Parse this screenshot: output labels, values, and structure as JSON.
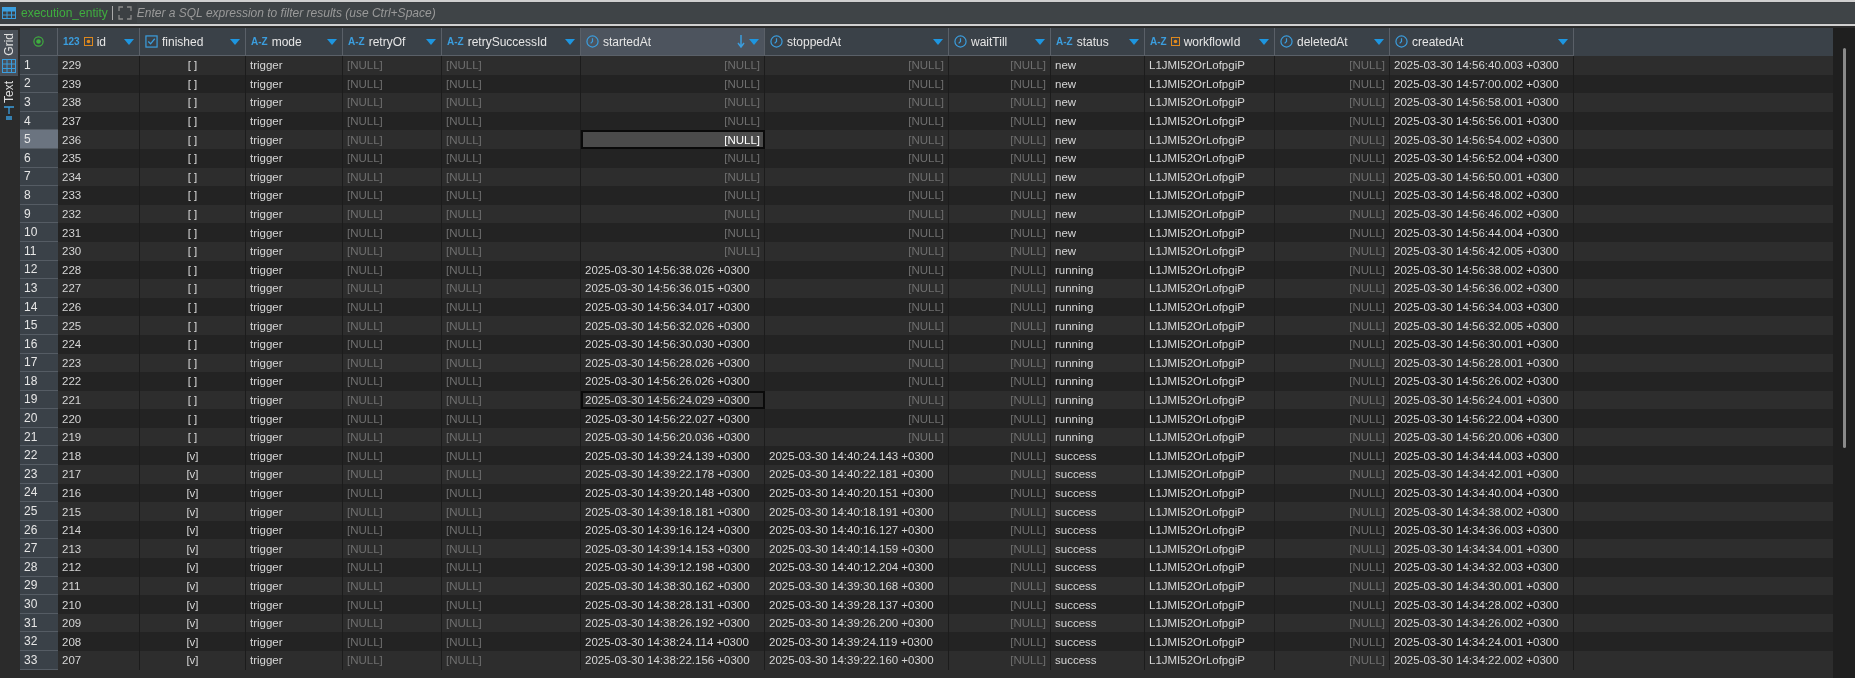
{
  "filter_bar": {
    "table_name": "execution_entity",
    "placeholder": "Enter a SQL expression to filter results (use Ctrl+Space)"
  },
  "view_tabs": [
    {
      "label": "Grid",
      "selected": true
    },
    {
      "label": "Text",
      "selected": false
    }
  ],
  "columns": [
    {
      "label": "id",
      "kind": "number",
      "type_label": "123",
      "key": true,
      "sorted": false
    },
    {
      "label": "finished",
      "kind": "boolean",
      "key": false,
      "sorted": false
    },
    {
      "label": "mode",
      "kind": "text",
      "type_label": "A-Z",
      "key": false,
      "sorted": false
    },
    {
      "label": "retryOf",
      "kind": "text",
      "type_label": "A-Z",
      "key": false,
      "sorted": false
    },
    {
      "label": "retrySuccessId",
      "kind": "text",
      "type_label": "A-Z",
      "key": false,
      "sorted": false
    },
    {
      "label": "startedAt",
      "kind": "datetime",
      "key": false,
      "sorted": true
    },
    {
      "label": "stoppedAt",
      "kind": "datetime",
      "key": false,
      "sorted": false
    },
    {
      "label": "waitTill",
      "kind": "datetime",
      "key": false,
      "sorted": false
    },
    {
      "label": "status",
      "kind": "text",
      "type_label": "A-Z",
      "key": false,
      "sorted": false
    },
    {
      "label": "workflowId",
      "kind": "text",
      "type_label": "A-Z",
      "key": true,
      "sorted": false
    },
    {
      "label": "deletedAt",
      "kind": "datetime",
      "key": false,
      "sorted": false
    },
    {
      "label": "createdAt",
      "kind": "datetime",
      "key": false,
      "sorted": false
    }
  ],
  "rows": [
    {
      "number": "1",
      "selected": false,
      "outlined": false,
      "cells": [
        "229",
        "[ ]",
        "trigger",
        {
          "text": "[NULL]",
          "null": true
        },
        {
          "text": "[NULL]",
          "null": true
        },
        {
          "text": "[NULL]",
          "null": true
        },
        {
          "text": "[NULL]",
          "null": true
        },
        {
          "text": "[NULL]",
          "null": true
        },
        "new",
        "L1JMI52OrLofpgiP",
        {
          "text": "[NULL]",
          "null": true
        },
        "2025-03-30 14:56:40.003 +0300"
      ]
    },
    {
      "number": "2",
      "selected": false,
      "outlined": false,
      "cells": [
        "239",
        "[ ]",
        "trigger",
        {
          "text": "[NULL]",
          "null": true
        },
        {
          "text": "[NULL]",
          "null": true
        },
        {
          "text": "[NULL]",
          "null": true
        },
        {
          "text": "[NULL]",
          "null": true
        },
        {
          "text": "[NULL]",
          "null": true
        },
        "new",
        "L1JMI52OrLofpgiP",
        {
          "text": "[NULL]",
          "null": true
        },
        "2025-03-30 14:57:00.002 +0300"
      ]
    },
    {
      "number": "3",
      "selected": false,
      "outlined": false,
      "cells": [
        "238",
        "[ ]",
        "trigger",
        {
          "text": "[NULL]",
          "null": true
        },
        {
          "text": "[NULL]",
          "null": true
        },
        {
          "text": "[NULL]",
          "null": true
        },
        {
          "text": "[NULL]",
          "null": true
        },
        {
          "text": "[NULL]",
          "null": true
        },
        "new",
        "L1JMI52OrLofpgiP",
        {
          "text": "[NULL]",
          "null": true
        },
        "2025-03-30 14:56:58.001 +0300"
      ]
    },
    {
      "number": "4",
      "selected": false,
      "outlined": false,
      "cells": [
        "237",
        "[ ]",
        "trigger",
        {
          "text": "[NULL]",
          "null": true
        },
        {
          "text": "[NULL]",
          "null": true
        },
        {
          "text": "[NULL]",
          "null": true
        },
        {
          "text": "[NULL]",
          "null": true
        },
        {
          "text": "[NULL]",
          "null": true
        },
        "new",
        "L1JMI52OrLofpgiP",
        {
          "text": "[NULL]",
          "null": true
        },
        "2025-03-30 14:56:56.001 +0300"
      ]
    },
    {
      "number": "5",
      "selected": true,
      "outlined": false,
      "cells": [
        "236",
        "[ ]",
        "trigger",
        {
          "text": "[NULL]",
          "null": true
        },
        {
          "text": "[NULL]",
          "null": true
        },
        {
          "text": "[NULL]",
          "null": true
        },
        {
          "text": "[NULL]",
          "null": true
        },
        {
          "text": "[NULL]",
          "null": true
        },
        "new",
        "L1JMI52OrLofpgiP",
        {
          "text": "[NULL]",
          "null": true
        },
        "2025-03-30 14:56:54.002 +0300"
      ]
    },
    {
      "number": "6",
      "selected": false,
      "outlined": false,
      "cells": [
        "235",
        "[ ]",
        "trigger",
        {
          "text": "[NULL]",
          "null": true
        },
        {
          "text": "[NULL]",
          "null": true
        },
        {
          "text": "[NULL]",
          "null": true
        },
        {
          "text": "[NULL]",
          "null": true
        },
        {
          "text": "[NULL]",
          "null": true
        },
        "new",
        "L1JMI52OrLofpgiP",
        {
          "text": "[NULL]",
          "null": true
        },
        "2025-03-30 14:56:52.004 +0300"
      ]
    },
    {
      "number": "7",
      "selected": false,
      "outlined": false,
      "cells": [
        "234",
        "[ ]",
        "trigger",
        {
          "text": "[NULL]",
          "null": true
        },
        {
          "text": "[NULL]",
          "null": true
        },
        {
          "text": "[NULL]",
          "null": true
        },
        {
          "text": "[NULL]",
          "null": true
        },
        {
          "text": "[NULL]",
          "null": true
        },
        "new",
        "L1JMI52OrLofpgiP",
        {
          "text": "[NULL]",
          "null": true
        },
        "2025-03-30 14:56:50.001 +0300"
      ]
    },
    {
      "number": "8",
      "selected": false,
      "outlined": false,
      "cells": [
        "233",
        "[ ]",
        "trigger",
        {
          "text": "[NULL]",
          "null": true
        },
        {
          "text": "[NULL]",
          "null": true
        },
        {
          "text": "[NULL]",
          "null": true
        },
        {
          "text": "[NULL]",
          "null": true
        },
        {
          "text": "[NULL]",
          "null": true
        },
        "new",
        "L1JMI52OrLofpgiP",
        {
          "text": "[NULL]",
          "null": true
        },
        "2025-03-30 14:56:48.002 +0300"
      ]
    },
    {
      "number": "9",
      "selected": false,
      "outlined": false,
      "cells": [
        "232",
        "[ ]",
        "trigger",
        {
          "text": "[NULL]",
          "null": true
        },
        {
          "text": "[NULL]",
          "null": true
        },
        {
          "text": "[NULL]",
          "null": true
        },
        {
          "text": "[NULL]",
          "null": true
        },
        {
          "text": "[NULL]",
          "null": true
        },
        "new",
        "L1JMI52OrLofpgiP",
        {
          "text": "[NULL]",
          "null": true
        },
        "2025-03-30 14:56:46.002 +0300"
      ]
    },
    {
      "number": "10",
      "selected": false,
      "outlined": false,
      "cells": [
        "231",
        "[ ]",
        "trigger",
        {
          "text": "[NULL]",
          "null": true
        },
        {
          "text": "[NULL]",
          "null": true
        },
        {
          "text": "[NULL]",
          "null": true
        },
        {
          "text": "[NULL]",
          "null": true
        },
        {
          "text": "[NULL]",
          "null": true
        },
        "new",
        "L1JMI52OrLofpgiP",
        {
          "text": "[NULL]",
          "null": true
        },
        "2025-03-30 14:56:44.004 +0300"
      ]
    },
    {
      "number": "11",
      "selected": false,
      "outlined": false,
      "cells": [
        "230",
        "[ ]",
        "trigger",
        {
          "text": "[NULL]",
          "null": true
        },
        {
          "text": "[NULL]",
          "null": true
        },
        {
          "text": "[NULL]",
          "null": true
        },
        {
          "text": "[NULL]",
          "null": true
        },
        {
          "text": "[NULL]",
          "null": true
        },
        "new",
        "L1JMI52OrLofpgiP",
        {
          "text": "[NULL]",
          "null": true
        },
        "2025-03-30 14:56:42.005 +0300"
      ]
    },
    {
      "number": "12",
      "selected": false,
      "outlined": false,
      "cells": [
        "228",
        "[ ]",
        "trigger",
        {
          "text": "[NULL]",
          "null": true
        },
        {
          "text": "[NULL]",
          "null": true
        },
        "2025-03-30 14:56:38.026 +0300",
        {
          "text": "[NULL]",
          "null": true
        },
        {
          "text": "[NULL]",
          "null": true
        },
        "running",
        "L1JMI52OrLofpgiP",
        {
          "text": "[NULL]",
          "null": true
        },
        "2025-03-30 14:56:38.002 +0300"
      ]
    },
    {
      "number": "13",
      "selected": false,
      "outlined": false,
      "cells": [
        "227",
        "[ ]",
        "trigger",
        {
          "text": "[NULL]",
          "null": true
        },
        {
          "text": "[NULL]",
          "null": true
        },
        "2025-03-30 14:56:36.015 +0300",
        {
          "text": "[NULL]",
          "null": true
        },
        {
          "text": "[NULL]",
          "null": true
        },
        "running",
        "L1JMI52OrLofpgiP",
        {
          "text": "[NULL]",
          "null": true
        },
        "2025-03-30 14:56:36.002 +0300"
      ]
    },
    {
      "number": "14",
      "selected": false,
      "outlined": false,
      "cells": [
        "226",
        "[ ]",
        "trigger",
        {
          "text": "[NULL]",
          "null": true
        },
        {
          "text": "[NULL]",
          "null": true
        },
        "2025-03-30 14:56:34.017 +0300",
        {
          "text": "[NULL]",
          "null": true
        },
        {
          "text": "[NULL]",
          "null": true
        },
        "running",
        "L1JMI52OrLofpgiP",
        {
          "text": "[NULL]",
          "null": true
        },
        "2025-03-30 14:56:34.003 +0300"
      ]
    },
    {
      "number": "15",
      "selected": false,
      "outlined": false,
      "cells": [
        "225",
        "[ ]",
        "trigger",
        {
          "text": "[NULL]",
          "null": true
        },
        {
          "text": "[NULL]",
          "null": true
        },
        "2025-03-30 14:56:32.026 +0300",
        {
          "text": "[NULL]",
          "null": true
        },
        {
          "text": "[NULL]",
          "null": true
        },
        "running",
        "L1JMI52OrLofpgiP",
        {
          "text": "[NULL]",
          "null": true
        },
        "2025-03-30 14:56:32.005 +0300"
      ]
    },
    {
      "number": "16",
      "selected": false,
      "outlined": false,
      "cells": [
        "224",
        "[ ]",
        "trigger",
        {
          "text": "[NULL]",
          "null": true
        },
        {
          "text": "[NULL]",
          "null": true
        },
        "2025-03-30 14:56:30.030 +0300",
        {
          "text": "[NULL]",
          "null": true
        },
        {
          "text": "[NULL]",
          "null": true
        },
        "running",
        "L1JMI52OrLofpgiP",
        {
          "text": "[NULL]",
          "null": true
        },
        "2025-03-30 14:56:30.001 +0300"
      ]
    },
    {
      "number": "17",
      "selected": false,
      "outlined": false,
      "cells": [
        "223",
        "[ ]",
        "trigger",
        {
          "text": "[NULL]",
          "null": true
        },
        {
          "text": "[NULL]",
          "null": true
        },
        "2025-03-30 14:56:28.026 +0300",
        {
          "text": "[NULL]",
          "null": true
        },
        {
          "text": "[NULL]",
          "null": true
        },
        "running",
        "L1JMI52OrLofpgiP",
        {
          "text": "[NULL]",
          "null": true
        },
        "2025-03-30 14:56:28.001 +0300"
      ]
    },
    {
      "number": "18",
      "selected": false,
      "outlined": false,
      "cells": [
        "222",
        "[ ]",
        "trigger",
        {
          "text": "[NULL]",
          "null": true
        },
        {
          "text": "[NULL]",
          "null": true
        },
        "2025-03-30 14:56:26.026 +0300",
        {
          "text": "[NULL]",
          "null": true
        },
        {
          "text": "[NULL]",
          "null": true
        },
        "running",
        "L1JMI52OrLofpgiP",
        {
          "text": "[NULL]",
          "null": true
        },
        "2025-03-30 14:56:26.002 +0300"
      ]
    },
    {
      "number": "19",
      "selected": false,
      "outlined": true,
      "cells": [
        "221",
        "[ ]",
        "trigger",
        {
          "text": "[NULL]",
          "null": true
        },
        {
          "text": "[NULL]",
          "null": true
        },
        "2025-03-30 14:56:24.029 +0300",
        {
          "text": "[NULL]",
          "null": true
        },
        {
          "text": "[NULL]",
          "null": true
        },
        "running",
        "L1JMI52OrLofpgiP",
        {
          "text": "[NULL]",
          "null": true
        },
        "2025-03-30 14:56:24.001 +0300"
      ]
    },
    {
      "number": "20",
      "selected": false,
      "outlined": false,
      "cells": [
        "220",
        "[ ]",
        "trigger",
        {
          "text": "[NULL]",
          "null": true
        },
        {
          "text": "[NULL]",
          "null": true
        },
        "2025-03-30 14:56:22.027 +0300",
        {
          "text": "[NULL]",
          "null": true
        },
        {
          "text": "[NULL]",
          "null": true
        },
        "running",
        "L1JMI52OrLofpgiP",
        {
          "text": "[NULL]",
          "null": true
        },
        "2025-03-30 14:56:22.004 +0300"
      ]
    },
    {
      "number": "21",
      "selected": false,
      "outlined": false,
      "cells": [
        "219",
        "[ ]",
        "trigger",
        {
          "text": "[NULL]",
          "null": true
        },
        {
          "text": "[NULL]",
          "null": true
        },
        "2025-03-30 14:56:20.036 +0300",
        {
          "text": "[NULL]",
          "null": true
        },
        {
          "text": "[NULL]",
          "null": true
        },
        "running",
        "L1JMI52OrLofpgiP",
        {
          "text": "[NULL]",
          "null": true
        },
        "2025-03-30 14:56:20.006 +0300"
      ]
    },
    {
      "number": "22",
      "selected": false,
      "outlined": false,
      "cells": [
        "218",
        "[v]",
        "trigger",
        {
          "text": "[NULL]",
          "null": true
        },
        {
          "text": "[NULL]",
          "null": true
        },
        "2025-03-30 14:39:24.139 +0300",
        "2025-03-30 14:40:24.143 +0300",
        {
          "text": "[NULL]",
          "null": true
        },
        "success",
        "L1JMI52OrLofpgiP",
        {
          "text": "[NULL]",
          "null": true
        },
        "2025-03-30 14:34:44.003 +0300"
      ]
    },
    {
      "number": "23",
      "selected": false,
      "outlined": false,
      "cells": [
        "217",
        "[v]",
        "trigger",
        {
          "text": "[NULL]",
          "null": true
        },
        {
          "text": "[NULL]",
          "null": true
        },
        "2025-03-30 14:39:22.178 +0300",
        "2025-03-30 14:40:22.181 +0300",
        {
          "text": "[NULL]",
          "null": true
        },
        "success",
        "L1JMI52OrLofpgiP",
        {
          "text": "[NULL]",
          "null": true
        },
        "2025-03-30 14:34:42.001 +0300"
      ]
    },
    {
      "number": "24",
      "selected": false,
      "outlined": false,
      "cells": [
        "216",
        "[v]",
        "trigger",
        {
          "text": "[NULL]",
          "null": true
        },
        {
          "text": "[NULL]",
          "null": true
        },
        "2025-03-30 14:39:20.148 +0300",
        "2025-03-30 14:40:20.151 +0300",
        {
          "text": "[NULL]",
          "null": true
        },
        "success",
        "L1JMI52OrLofpgiP",
        {
          "text": "[NULL]",
          "null": true
        },
        "2025-03-30 14:34:40.004 +0300"
      ]
    },
    {
      "number": "25",
      "selected": false,
      "outlined": false,
      "cells": [
        "215",
        "[v]",
        "trigger",
        {
          "text": "[NULL]",
          "null": true
        },
        {
          "text": "[NULL]",
          "null": true
        },
        "2025-03-30 14:39:18.181 +0300",
        "2025-03-30 14:40:18.191 +0300",
        {
          "text": "[NULL]",
          "null": true
        },
        "success",
        "L1JMI52OrLofpgiP",
        {
          "text": "[NULL]",
          "null": true
        },
        "2025-03-30 14:34:38.002 +0300"
      ]
    },
    {
      "number": "26",
      "selected": false,
      "outlined": false,
      "cells": [
        "214",
        "[v]",
        "trigger",
        {
          "text": "[NULL]",
          "null": true
        },
        {
          "text": "[NULL]",
          "null": true
        },
        "2025-03-30 14:39:16.124 +0300",
        "2025-03-30 14:40:16.127 +0300",
        {
          "text": "[NULL]",
          "null": true
        },
        "success",
        "L1JMI52OrLofpgiP",
        {
          "text": "[NULL]",
          "null": true
        },
        "2025-03-30 14:34:36.003 +0300"
      ]
    },
    {
      "number": "27",
      "selected": false,
      "outlined": false,
      "cells": [
        "213",
        "[v]",
        "trigger",
        {
          "text": "[NULL]",
          "null": true
        },
        {
          "text": "[NULL]",
          "null": true
        },
        "2025-03-30 14:39:14.153 +0300",
        "2025-03-30 14:40:14.159 +0300",
        {
          "text": "[NULL]",
          "null": true
        },
        "success",
        "L1JMI52OrLofpgiP",
        {
          "text": "[NULL]",
          "null": true
        },
        "2025-03-30 14:34:34.001 +0300"
      ]
    },
    {
      "number": "28",
      "selected": false,
      "outlined": false,
      "cells": [
        "212",
        "[v]",
        "trigger",
        {
          "text": "[NULL]",
          "null": true
        },
        {
          "text": "[NULL]",
          "null": true
        },
        "2025-03-30 14:39:12.198 +0300",
        "2025-03-30 14:40:12.204 +0300",
        {
          "text": "[NULL]",
          "null": true
        },
        "success",
        "L1JMI52OrLofpgiP",
        {
          "text": "[NULL]",
          "null": true
        },
        "2025-03-30 14:34:32.003 +0300"
      ]
    },
    {
      "number": "29",
      "selected": false,
      "outlined": false,
      "cells": [
        "211",
        "[v]",
        "trigger",
        {
          "text": "[NULL]",
          "null": true
        },
        {
          "text": "[NULL]",
          "null": true
        },
        "2025-03-30 14:38:30.162 +0300",
        "2025-03-30 14:39:30.168 +0300",
        {
          "text": "[NULL]",
          "null": true
        },
        "success",
        "L1JMI52OrLofpgiP",
        {
          "text": "[NULL]",
          "null": true
        },
        "2025-03-30 14:34:30.001 +0300"
      ]
    },
    {
      "number": "30",
      "selected": false,
      "outlined": false,
      "cells": [
        "210",
        "[v]",
        "trigger",
        {
          "text": "[NULL]",
          "null": true
        },
        {
          "text": "[NULL]",
          "null": true
        },
        "2025-03-30 14:38:28.131 +0300",
        "2025-03-30 14:39:28.137 +0300",
        {
          "text": "[NULL]",
          "null": true
        },
        "success",
        "L1JMI52OrLofpgiP",
        {
          "text": "[NULL]",
          "null": true
        },
        "2025-03-30 14:34:28.002 +0300"
      ]
    },
    {
      "number": "31",
      "selected": false,
      "outlined": false,
      "cells": [
        "209",
        "[v]",
        "trigger",
        {
          "text": "[NULL]",
          "null": true
        },
        {
          "text": "[NULL]",
          "null": true
        },
        "2025-03-30 14:38:26.192 +0300",
        "2025-03-30 14:39:26.200 +0300",
        {
          "text": "[NULL]",
          "null": true
        },
        "success",
        "L1JMI52OrLofpgiP",
        {
          "text": "[NULL]",
          "null": true
        },
        "2025-03-30 14:34:26.002 +0300"
      ]
    },
    {
      "number": "32",
      "selected": false,
      "outlined": false,
      "cells": [
        "208",
        "[v]",
        "trigger",
        {
          "text": "[NULL]",
          "null": true
        },
        {
          "text": "[NULL]",
          "null": true
        },
        "2025-03-30 14:38:24.114 +0300",
        "2025-03-30 14:39:24.119 +0300",
        {
          "text": "[NULL]",
          "null": true
        },
        "success",
        "L1JMI52OrLofpgiP",
        {
          "text": "[NULL]",
          "null": true
        },
        "2025-03-30 14:34:24.001 +0300"
      ]
    },
    {
      "number": "33",
      "selected": false,
      "outlined": false,
      "cells": [
        "207",
        "[v]",
        "trigger",
        {
          "text": "[NULL]",
          "null": true
        },
        {
          "text": "[NULL]",
          "null": true
        },
        "2025-03-30 14:38:22.156 +0300",
        "2025-03-30 14:39:22.160 +0300",
        {
          "text": "[NULL]",
          "null": true
        },
        "success",
        "L1JMI52OrLofpgiP",
        {
          "text": "[NULL]",
          "null": true
        },
        "2025-03-30 14:34:22.002 +0300"
      ]
    }
  ]
}
